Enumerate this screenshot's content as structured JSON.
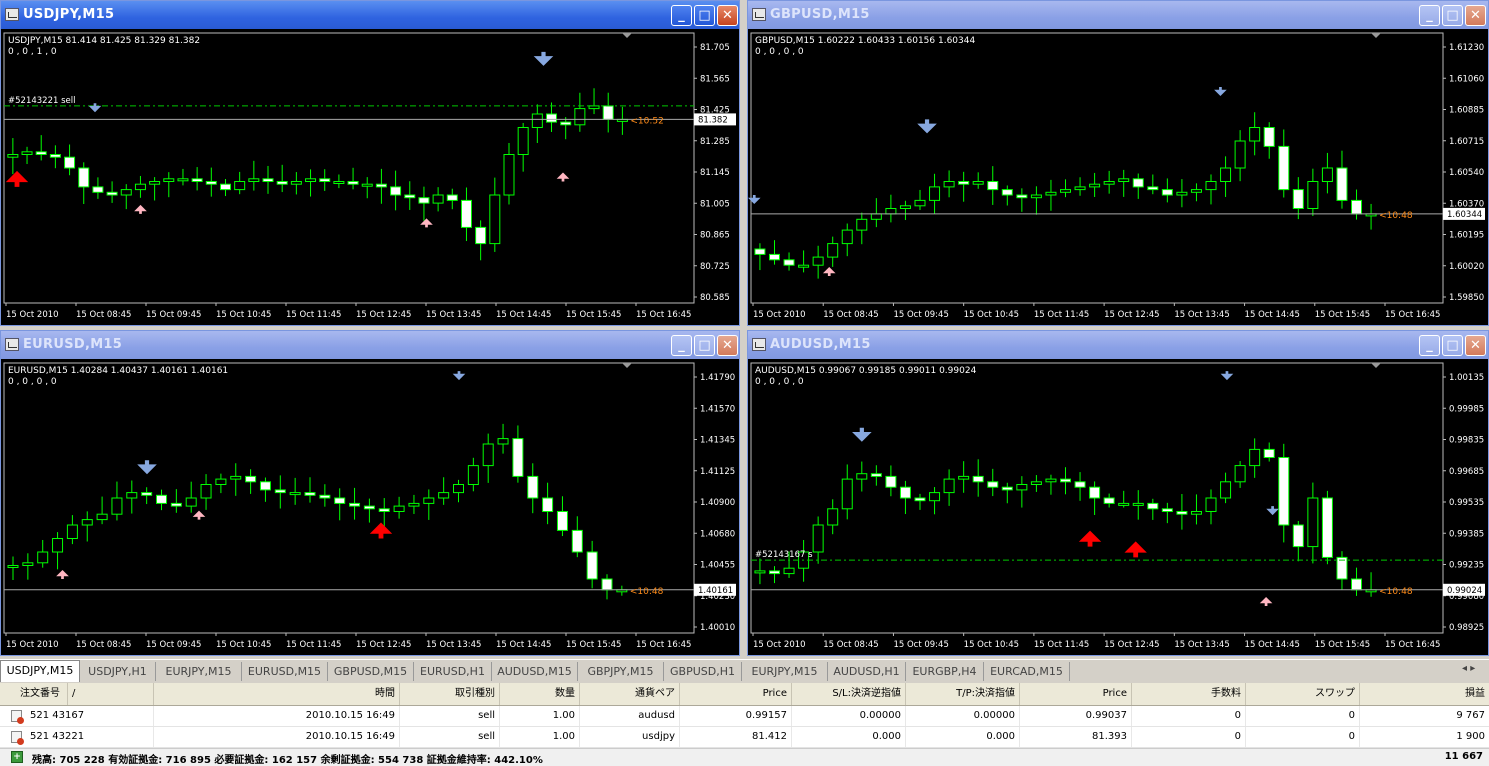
{
  "windows": [
    {
      "id": "usdjpy",
      "title": "USDJPY,M15",
      "active": true,
      "info_line": "USDJPY,M15  81.414 81.425 81.329 81.382",
      "ind_line": "0 , 0 , 1 , 0",
      "y_labels": [
        "81.705",
        "81.565",
        "81.425",
        "81.285",
        "81.145",
        "81.005",
        "80.865",
        "80.725",
        "80.585"
      ],
      "price_label": "81.382",
      "timer_label": "<10:52",
      "order_label": "#52143221 sell",
      "x_labels": [
        "15 Oct 2010",
        "15 Oct 08:45",
        "15 Oct 09:45",
        "15 Oct 10:45",
        "15 Oct 11:45",
        "15 Oct 12:45",
        "15 Oct 13:45",
        "15 Oct 14:45",
        "15 Oct 15:45",
        "15 Oct 16:45"
      ]
    },
    {
      "id": "gbpusd",
      "title": "GBPUSD,M15",
      "active": false,
      "info_line": "GBPUSD,M15  1.60222 1.60433 1.60156 1.60344",
      "ind_line": "0 , 0 , 0 , 0",
      "y_labels": [
        "1.61230",
        "1.61060",
        "1.60885",
        "1.60715",
        "1.60540",
        "1.60370",
        "1.60195",
        "1.60020",
        "1.59850"
      ],
      "price_label": "1.60344",
      "timer_label": "<10:48",
      "order_label": "",
      "x_labels": [
        "15 Oct 2010",
        "15 Oct 08:45",
        "15 Oct 09:45",
        "15 Oct 10:45",
        "15 Oct 11:45",
        "15 Oct 12:45",
        "15 Oct 13:45",
        "15 Oct 14:45",
        "15 Oct 15:45",
        "15 Oct 16:45"
      ]
    },
    {
      "id": "eurusd",
      "title": "EURUSD,M15",
      "active": false,
      "info_line": "EURUSD,M15  1.40284 1.40437 1.40161 1.40161",
      "ind_line": "0 , 0 , 0 , 0",
      "y_labels": [
        "1.41790",
        "1.41570",
        "1.41345",
        "1.41125",
        "1.40900",
        "1.40680",
        "1.40455",
        "1.40230",
        "1.40010"
      ],
      "price_label": "1.40161",
      "timer_label": "<10:48",
      "order_label": "",
      "x_labels": [
        "15 Oct 2010",
        "15 Oct 08:45",
        "15 Oct 09:45",
        "15 Oct 10:45",
        "15 Oct 11:45",
        "15 Oct 12:45",
        "15 Oct 13:45",
        "15 Oct 14:45",
        "15 Oct 15:45",
        "15 Oct 16:45"
      ]
    },
    {
      "id": "audusd",
      "title": "AUDUSD,M15",
      "active": false,
      "info_line": "AUDUSD,M15  0.99067 0.99185 0.99011 0.99024",
      "ind_line": "0 , 0 , 0 , 0",
      "y_labels": [
        "1.00135",
        "0.99985",
        "0.99835",
        "0.99685",
        "0.99535",
        "0.99385",
        "0.99235",
        "0.99080",
        "0.98925"
      ],
      "price_label": "0.99024",
      "timer_label": "<10:48",
      "order_label": "#52143167 s",
      "x_labels": [
        "15 Oct 2010",
        "15 Oct 08:45",
        "15 Oct 09:45",
        "15 Oct 10:45",
        "15 Oct 11:45",
        "15 Oct 12:45",
        "15 Oct 13:45",
        "15 Oct 14:45",
        "15 Oct 15:45",
        "15 Oct 16:45"
      ]
    }
  ],
  "tabs": [
    "USDJPY,M15",
    "USDJPY,H1",
    "EURJPY,M15",
    "EURUSD,M15",
    "GBPUSD,M15",
    "EURUSD,H1",
    "AUDUSD,M15",
    "GBPJPY,M15",
    "GBPUSD,H1",
    "EURJPY,M15",
    "AUDUSD,H1",
    "EURGBP,H4",
    "EURCAD,M15"
  ],
  "tab_scroll": "◂  ▸",
  "terminal": {
    "headers": [
      "注文番号",
      "/",
      "時間",
      "取引種別",
      "数量",
      "通貨ペア",
      "Price",
      "S/L:決済逆指値",
      "T/P:決済指値",
      "Price",
      "手数料",
      "スワップ",
      "損益"
    ],
    "rows": [
      [
        "521 43167",
        "2010.10.15 16:49",
        "sell",
        "1.00",
        "audusd",
        "0.99157",
        "0.00000",
        "0.00000",
        "0.99037",
        "0",
        "0",
        "9 767"
      ],
      [
        "521 43221",
        "2010.10.15 16:49",
        "sell",
        "1.00",
        "usdjpy",
        "81.412",
        "0.000",
        "0.000",
        "81.393",
        "0",
        "0",
        "1 900"
      ]
    ],
    "summary": "残高: 705 228  有効証拠金: 716 895  必要証拠金: 162 157  余剰証拠金: 554 738  証拠金維持率: 442.10%",
    "summary_profit": "11 667"
  },
  "colors": {
    "bull_fill": "#000000",
    "bear_fill": "#ffffff",
    "candle_stroke": "#00ff00",
    "up_arrow_big": "#ff0000",
    "up_arrow_small": "#ffb6c1",
    "down_arrow": "#87a8e0"
  }
}
